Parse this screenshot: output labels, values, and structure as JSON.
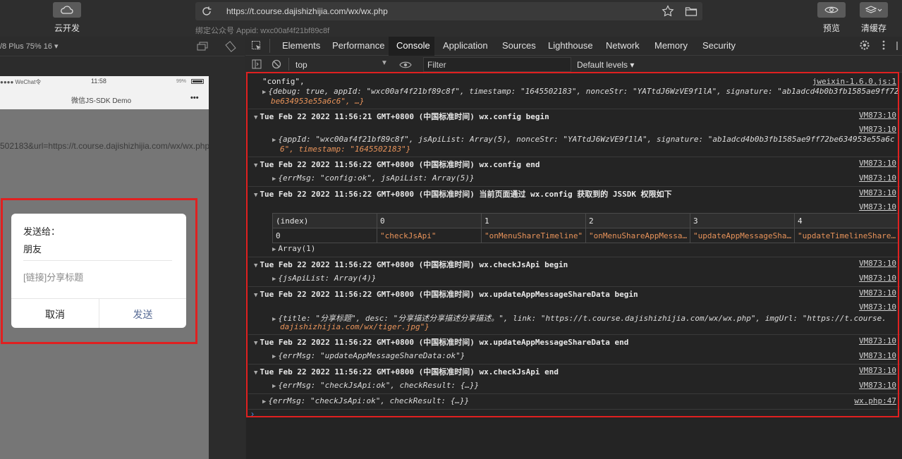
{
  "topbar": {
    "cloud_label": "云开发",
    "url": "https://t.course.dajishizhijia.com/wx/wx.php",
    "appid_line": "绑定公众号 Appid: wxc00af4f21bf89c8f",
    "preview_label": "预览",
    "clear_label": "清缓存"
  },
  "simulator": {
    "device_label": "/8 Plus 75% 16 ▾",
    "status_carrier": "●●●● WeChat令",
    "status_time": "11:58",
    "status_battery": "99%",
    "nav_title": "微信JS-SDK Demo",
    "nav_more": "•••",
    "url_fragment": "502183&url=https://t.course.dajishizhijia.com/wx/wx.php"
  },
  "dialog": {
    "send_to": "发送给：",
    "recipient": "朋友",
    "link_title": "[链接]分享标题",
    "cancel": "取消",
    "send": "发送"
  },
  "devtools": {
    "tabs": [
      "Elements",
      "Performance",
      "Console",
      "Application",
      "Sources",
      "Lighthouse",
      "Network",
      "Memory",
      "Security"
    ],
    "active_tab": "Console",
    "context": "top",
    "filter_placeholder": "Filter",
    "levels": "Default levels ▾"
  },
  "console": {
    "l1_text": "\"config\",",
    "l1_src": "jweixin-1.6.0.js:1",
    "l2_text": "{debug: true, appId: \"wxc00af4f21bf89c8f\", timestamp: \"1645502183\", nonceStr: \"YATtdJ6WzVE9f1lA\", signature: \"ab1adcd4b0b3fb1585ae9ff72",
    "l3_text": "be634953e55a6c6\", …}",
    "g1": "Tue Feb 22 2022 11:56:21 GMT+0800 (中国标准时间) wx.config begin",
    "src_vm": "VM873:10",
    "g1_obj_a": "{appId: \"wxc00af4f21bf89c8f\", jsApiList: Array(5), nonceStr: \"YATtdJ6WzVE9f1lA\", signature: \"ab1adcd4b0b3fb1585ae9ff72be634953e55a6c",
    "g1_obj_b": "6\", timestamp: \"1645502183\"}",
    "g2": "Tue Feb 22 2022 11:56:22 GMT+0800 (中国标准时间) wx.config end",
    "g2_obj": "{errMsg: \"config:ok\", jsApiList: Array(5)}",
    "g3": "Tue Feb 22 2022 11:56:22 GMT+0800 (中国标准时间) 当前页面通过 wx.config 获取到的 JSSDK 权限如下",
    "table_head": [
      "(index)",
      "0",
      "1",
      "2",
      "3",
      "4"
    ],
    "table_row": [
      "0",
      "\"checkJsApi\"",
      "\"onMenuShareTimeline\"",
      "\"onMenuShareAppMessa…",
      "\"updateAppMessageSha…",
      "\"updateTimelineShare…"
    ],
    "array1": "Array(1)",
    "g4": "Tue Feb 22 2022 11:56:22 GMT+0800 (中国标准时间) wx.checkJsApi begin",
    "g4_obj": "{jsApiList: Array(4)}",
    "g5": "Tue Feb 22 2022 11:56:22 GMT+0800 (中国标准时间) wx.updateAppMessageShareData begin",
    "g5_obj_a": "{title: \"分享标题\", desc: \"分享描述分享描述分享描述。\", link: \"https://t.course.dajishizhijia.com/wx/wx.php\", imgUrl: \"https://t.course.",
    "g5_obj_b": "dajishizhijia.com/wx/tiger.jpg\"}",
    "g6": "Tue Feb 22 2022 11:56:22 GMT+0800 (中国标准时间) wx.updateAppMessageShareData end",
    "g6_obj": "{errMsg: \"updateAppMessageShareData:ok\"}",
    "g7": "Tue Feb 22 2022 11:56:22 GMT+0800 (中国标准时间) wx.checkJsApi end",
    "g7_obj": "{errMsg: \"checkJsApi:ok\", checkResult: {…}}",
    "last_obj": "{errMsg: \"checkJsApi:ok\", checkResult: {…}}",
    "last_src": "wx.php:47",
    "prompt": "›"
  },
  "colors": {
    "accent_red": "#e02020",
    "string": "#e8935a",
    "bool": "#9980ff"
  }
}
